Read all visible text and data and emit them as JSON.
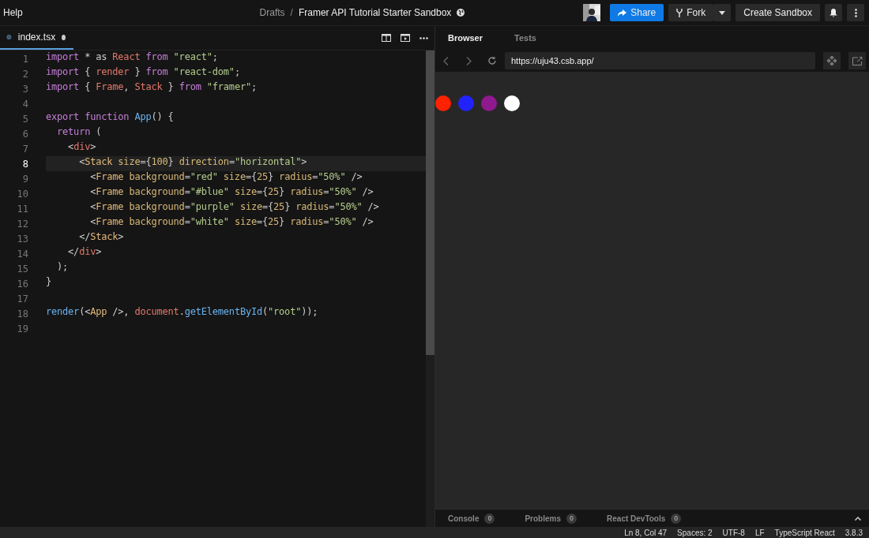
{
  "menu": {
    "label": "Help"
  },
  "breadcrumb": {
    "folder": "Drafts",
    "separator": "/",
    "title": "Framer API Tutorial Starter Sandbox"
  },
  "header_buttons": [
    {
      "label": "Share",
      "kind": "share"
    },
    {
      "label": "Fork",
      "kind": "fork"
    },
    {
      "label": "Create Sandbox",
      "kind": "plain"
    }
  ],
  "editor_tab": {
    "label": "index.tsx",
    "unsaved": true
  },
  "code": [
    {
      "number": "1",
      "current": false,
      "tokens": [
        {
          "kind": "k",
          "text": "import"
        },
        {
          "kind": "p",
          "text": " * as "
        },
        {
          "kind": "v",
          "text": "React"
        },
        {
          "kind": "k",
          "text": " from"
        },
        {
          "kind": "s",
          "text": " \"react\""
        },
        {
          "kind": "p",
          "text": ";"
        }
      ]
    },
    {
      "number": "2",
      "current": false,
      "tokens": [
        {
          "kind": "k",
          "text": "import"
        },
        {
          "kind": "p",
          "text": " { "
        },
        {
          "kind": "v",
          "text": "render"
        },
        {
          "kind": "p",
          "text": " } "
        },
        {
          "kind": "k",
          "text": "from"
        },
        {
          "kind": "s",
          "text": " \"react-dom\""
        },
        {
          "kind": "p",
          "text": ";"
        }
      ]
    },
    {
      "number": "3",
      "current": false,
      "tokens": [
        {
          "kind": "k",
          "text": "import"
        },
        {
          "kind": "p",
          "text": " { "
        },
        {
          "kind": "v",
          "text": "Frame"
        },
        {
          "kind": "p",
          "text": ", "
        },
        {
          "kind": "v",
          "text": "Stack"
        },
        {
          "kind": "p",
          "text": " } "
        },
        {
          "kind": "k",
          "text": "from"
        },
        {
          "kind": "s",
          "text": " \"framer\""
        },
        {
          "kind": "p",
          "text": ";"
        }
      ]
    },
    {
      "number": "4",
      "current": false
    },
    {
      "number": "5",
      "current": false,
      "tokens": [
        {
          "kind": "k",
          "text": "export"
        },
        {
          "kind": "k",
          "text": " function"
        },
        {
          "kind": "f",
          "text": " App"
        },
        {
          "kind": "p",
          "text": "() {"
        }
      ]
    },
    {
      "number": "6",
      "current": false,
      "tokens": [
        {
          "kind": "k",
          "text": "  return"
        },
        {
          "kind": "p",
          "text": " ("
        }
      ]
    },
    {
      "number": "7",
      "current": false,
      "tokens": [
        {
          "kind": "p",
          "text": "    <"
        },
        {
          "kind": "v",
          "text": "div"
        },
        {
          "kind": "p",
          "text": ">"
        }
      ]
    },
    {
      "number": "8",
      "current": true,
      "tokens": [
        {
          "kind": "p",
          "text": "      <"
        },
        {
          "kind": "t",
          "text": "Stack"
        },
        {
          "kind": "a",
          "text": " size"
        },
        {
          "kind": "p",
          "text": "={"
        },
        {
          "kind": "a",
          "text": "100"
        },
        {
          "kind": "p",
          "text": "} "
        },
        {
          "kind": "a",
          "text": "direction"
        },
        {
          "kind": "p",
          "text": "="
        },
        {
          "kind": "s",
          "text": "\"horizontal\""
        },
        {
          "kind": "p",
          "text": ">"
        }
      ]
    },
    {
      "number": "9",
      "current": false,
      "tokens": [
        {
          "kind": "p",
          "text": "        <"
        },
        {
          "kind": "t",
          "text": "Frame"
        },
        {
          "kind": "a",
          "text": " background"
        },
        {
          "kind": "p",
          "text": "="
        },
        {
          "kind": "s",
          "text": "\"red\""
        },
        {
          "kind": "a",
          "text": " size"
        },
        {
          "kind": "p",
          "text": "={"
        },
        {
          "kind": "a",
          "text": "25"
        },
        {
          "kind": "p",
          "text": "} "
        },
        {
          "kind": "a",
          "text": "radius"
        },
        {
          "kind": "p",
          "text": "="
        },
        {
          "kind": "s",
          "text": "\"50%\""
        },
        {
          "kind": "p",
          "text": " />"
        }
      ]
    },
    {
      "number": "10",
      "current": false,
      "tokens": [
        {
          "kind": "p",
          "text": "        <"
        },
        {
          "kind": "t",
          "text": "Frame"
        },
        {
          "kind": "a",
          "text": " background"
        },
        {
          "kind": "p",
          "text": "="
        },
        {
          "kind": "s",
          "text": "\"#blue\""
        },
        {
          "kind": "a",
          "text": " size"
        },
        {
          "kind": "p",
          "text": "={"
        },
        {
          "kind": "a",
          "text": "25"
        },
        {
          "kind": "p",
          "text": "} "
        },
        {
          "kind": "a",
          "text": "radius"
        },
        {
          "kind": "p",
          "text": "="
        },
        {
          "kind": "s",
          "text": "\"50%\""
        },
        {
          "kind": "p",
          "text": " />"
        }
      ]
    },
    {
      "number": "11",
      "current": false,
      "tokens": [
        {
          "kind": "p",
          "text": "        <"
        },
        {
          "kind": "t",
          "text": "Frame"
        },
        {
          "kind": "a",
          "text": " background"
        },
        {
          "kind": "p",
          "text": "="
        },
        {
          "kind": "s",
          "text": "\"purple\""
        },
        {
          "kind": "a",
          "text": " size"
        },
        {
          "kind": "p",
          "text": "={"
        },
        {
          "kind": "a",
          "text": "25"
        },
        {
          "kind": "p",
          "text": "} "
        },
        {
          "kind": "a",
          "text": "radius"
        },
        {
          "kind": "p",
          "text": "="
        },
        {
          "kind": "s",
          "text": "\"50%\""
        },
        {
          "kind": "p",
          "text": " />"
        }
      ]
    },
    {
      "number": "12",
      "current": false,
      "tokens": [
        {
          "kind": "p",
          "text": "        <"
        },
        {
          "kind": "t",
          "text": "Frame"
        },
        {
          "kind": "a",
          "text": " background"
        },
        {
          "kind": "p",
          "text": "="
        },
        {
          "kind": "s",
          "text": "\"white\""
        },
        {
          "kind": "a",
          "text": " size"
        },
        {
          "kind": "p",
          "text": "={"
        },
        {
          "kind": "a",
          "text": "25"
        },
        {
          "kind": "p",
          "text": "} "
        },
        {
          "kind": "a",
          "text": "radius"
        },
        {
          "kind": "p",
          "text": "="
        },
        {
          "kind": "s",
          "text": "\"50%\""
        },
        {
          "kind": "p",
          "text": " />"
        }
      ]
    },
    {
      "number": "13",
      "current": false,
      "tokens": [
        {
          "kind": "p",
          "text": "      </"
        },
        {
          "kind": "t",
          "text": "Stack"
        },
        {
          "kind": "p",
          "text": ">"
        }
      ]
    },
    {
      "number": "14",
      "current": false,
      "tokens": [
        {
          "kind": "p",
          "text": "    </"
        },
        {
          "kind": "v",
          "text": "div"
        },
        {
          "kind": "p",
          "text": ">"
        }
      ]
    },
    {
      "number": "15",
      "current": false,
      "tokens": [
        {
          "kind": "p",
          "text": "  );"
        }
      ]
    },
    {
      "number": "16",
      "current": false,
      "tokens": [
        {
          "kind": "p",
          "text": "}"
        }
      ]
    },
    {
      "number": "17",
      "current": false
    },
    {
      "number": "18",
      "current": false,
      "tokens": [
        {
          "kind": "f",
          "text": "render"
        },
        {
          "kind": "p",
          "text": "(<"
        },
        {
          "kind": "t",
          "text": "App"
        },
        {
          "kind": "p",
          "text": " />, "
        },
        {
          "kind": "v",
          "text": "document"
        },
        {
          "kind": "p",
          "text": "."
        },
        {
          "kind": "f",
          "text": "getElementById"
        },
        {
          "kind": "p",
          "text": "("
        },
        {
          "kind": "s",
          "text": "\"root\""
        },
        {
          "kind": "p",
          "text": "));"
        }
      ]
    },
    {
      "number": "19",
      "current": false
    }
  ],
  "preview_tabs": [
    {
      "label": "Browser",
      "selected": true
    },
    {
      "label": "Tests",
      "selected": false
    }
  ],
  "address_bar": {
    "value": "https://uju43.csb.app/"
  },
  "preview_circles": [
    {
      "color": "#ff2200"
    },
    {
      "color": "#2222ff"
    },
    {
      "color": "#8e1a8e"
    },
    {
      "color": "#ffffff"
    }
  ],
  "console_tabs": [
    {
      "label": "Console",
      "count": "0"
    },
    {
      "label": "Problems",
      "count": "0"
    },
    {
      "label": "React DevTools",
      "count": "0"
    }
  ],
  "status_bar": [
    "Ln 8, Col 47",
    "Spaces: 2",
    "UTF-8",
    "LF",
    "TypeScript React",
    "3.8.3"
  ]
}
